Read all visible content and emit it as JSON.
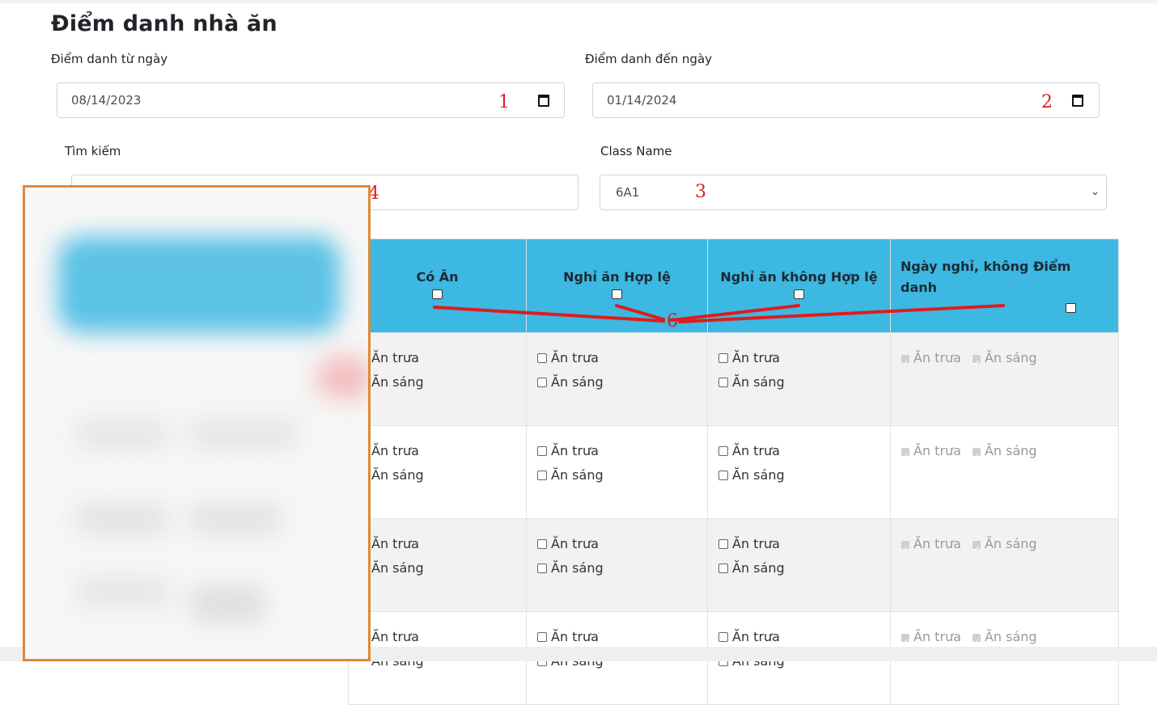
{
  "page": {
    "title": "Điểm danh nhà ăn"
  },
  "filters": {
    "from_label": "Điểm danh từ ngày",
    "from_value": "08/14/2023",
    "to_label": "Điểm danh đến ngày",
    "to_value": "01/14/2024",
    "search_label": "Tìm kiếm",
    "search_value": "",
    "class_label": "Class Name",
    "class_value": "6A1"
  },
  "annotations": {
    "m1": "1",
    "m2": "2",
    "m3": "3",
    "m4": "4",
    "m6": "6"
  },
  "table": {
    "headers": [
      "Có Ăn",
      "Nghỉ ăn Hợp lệ",
      "Nghỉ ăn không Hợp lệ",
      "Ngày nghỉ, không Điểm danh"
    ],
    "rows": [
      {
        "c1": [
          "Ăn trưa",
          "Ăn sáng"
        ],
        "c2": [
          "Ăn trưa",
          "Ăn sáng"
        ],
        "c3": [
          "Ăn trưa",
          "Ăn sáng"
        ],
        "c4": [
          "Ăn trưa",
          "Ăn sáng"
        ]
      },
      {
        "c1": [
          "Ăn trưa",
          "Ăn sáng"
        ],
        "c2": [
          "Ăn trưa",
          "Ăn sáng"
        ],
        "c3": [
          "Ăn trưa",
          "Ăn sáng"
        ],
        "c4": [
          "Ăn trưa",
          "Ăn sáng"
        ]
      },
      {
        "c1": [
          "Ăn trưa",
          "Ăn sáng"
        ],
        "c2": [
          "Ăn trưa",
          "Ăn sáng"
        ],
        "c3": [
          "Ăn trưa",
          "Ăn sáng"
        ],
        "c4": [
          "Ăn trưa",
          "Ăn sáng"
        ]
      },
      {
        "c1": [
          "Ăn trưa",
          "Ăn sáng"
        ],
        "c2": [
          "Ăn trưa",
          "Ăn sáng"
        ],
        "c3": [
          "Ăn trưa",
          "Ăn sáng"
        ],
        "c4": [
          "Ăn trưa",
          "Ăn sáng"
        ]
      }
    ]
  },
  "colors": {
    "header_bg": "#3cb8e2",
    "annotation_red": "#e01b1b",
    "redaction_border": "#e0883a"
  },
  "icons": {
    "date_picker": "calendar-icon",
    "select": "chevron-down-icon"
  }
}
